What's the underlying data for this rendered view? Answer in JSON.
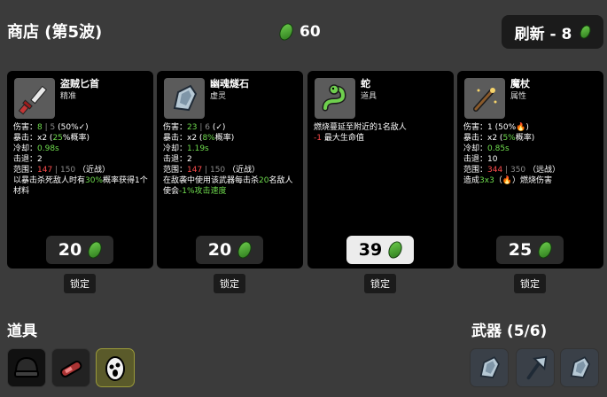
{
  "header": {
    "title": "商店 (第5波)",
    "materials": "60",
    "reroll_label": "刷新 - 8"
  },
  "shop_items": [
    {
      "name": "盗贼匕首",
      "class": "精准",
      "icon": "dagger-icon",
      "stats": [
        {
          "label": "伤害：",
          "parts": [
            {
              "t": "8",
              "c": "g"
            },
            {
              "t": " | ",
              "c": "gy"
            },
            {
              "t": "5",
              "c": "gy"
            },
            {
              "t": " (50%✓)",
              "c": ""
            }
          ]
        },
        {
          "label": "暴击：",
          "parts": [
            {
              "t": "x2 (",
              "c": ""
            },
            {
              "t": "25",
              "c": "g"
            },
            {
              "t": "%概率)",
              "c": ""
            }
          ]
        },
        {
          "label": "冷却：",
          "parts": [
            {
              "t": "0.98s",
              "c": "g"
            }
          ]
        },
        {
          "label": "击退：",
          "parts": [
            {
              "t": "2",
              "c": ""
            }
          ]
        },
        {
          "label": "范围：",
          "parts": [
            {
              "t": "147",
              "c": "r"
            },
            {
              "t": " | ",
              "c": "gy"
            },
            {
              "t": "150",
              "c": "gy"
            },
            {
              "t": " （近战）",
              "c": ""
            }
          ]
        }
      ],
      "desc_parts": [
        {
          "t": "以暴击杀死敌人时有",
          "c": ""
        },
        {
          "t": "30%",
          "c": "g"
        },
        {
          "t": "概率获得1个材料",
          "c": ""
        }
      ],
      "price": "20"
    },
    {
      "name": "幽魂燧石",
      "class": "虚灵",
      "icon": "ghost-flint-icon",
      "stats": [
        {
          "label": "伤害：",
          "parts": [
            {
              "t": "23",
              "c": "g"
            },
            {
              "t": " | ",
              "c": "gy"
            },
            {
              "t": "6",
              "c": "gy"
            },
            {
              "t": " (✓)",
              "c": ""
            }
          ]
        },
        {
          "label": "暴击：",
          "parts": [
            {
              "t": "x2 (",
              "c": ""
            },
            {
              "t": "8%",
              "c": "g"
            },
            {
              "t": "概率)",
              "c": ""
            }
          ]
        },
        {
          "label": "冷却：",
          "parts": [
            {
              "t": "1.19s",
              "c": "g"
            }
          ]
        },
        {
          "label": "击退：",
          "parts": [
            {
              "t": "2",
              "c": ""
            }
          ]
        },
        {
          "label": "范围：",
          "parts": [
            {
              "t": "147",
              "c": "r"
            },
            {
              "t": " | ",
              "c": "gy"
            },
            {
              "t": "150",
              "c": "gy"
            },
            {
              "t": " （近战）",
              "c": ""
            }
          ]
        }
      ],
      "desc_parts": [
        {
          "t": "在敌袭中使用该武器每击杀",
          "c": ""
        },
        {
          "t": "20",
          "c": "g"
        },
        {
          "t": "名敌人使会",
          "c": ""
        },
        {
          "t": "-1%攻击速度",
          "c": "g"
        }
      ],
      "price": "20"
    },
    {
      "name": "蛇",
      "class": "道具",
      "icon": "snake-icon",
      "stats": [],
      "desc_parts": [
        {
          "t": "燃烧蔓延至附近的1名敌人",
          "c": ""
        }
      ],
      "desc2_parts": [
        {
          "t": "-1",
          "c": "r"
        },
        {
          "t": " 最大生命值",
          "c": ""
        }
      ],
      "price": "39"
    },
    {
      "name": "魔杖",
      "class": "属性",
      "icon": "wand-icon",
      "stats": [
        {
          "label": "伤害：",
          "parts": [
            {
              "t": "1 (50%",
              "c": ""
            },
            {
              "t": "🔥",
              "c": ""
            },
            {
              "t": ")",
              "c": ""
            }
          ]
        },
        {
          "label": "暴击：",
          "parts": [
            {
              "t": "x2 (",
              "c": ""
            },
            {
              "t": "5%",
              "c": "g"
            },
            {
              "t": "概率)",
              "c": ""
            }
          ]
        },
        {
          "label": "冷却：",
          "parts": [
            {
              "t": "0.85s",
              "c": "g"
            }
          ]
        },
        {
          "label": "击退：",
          "parts": [
            {
              "t": "10",
              "c": ""
            }
          ]
        },
        {
          "label": "范围：",
          "parts": [
            {
              "t": "344",
              "c": "r"
            },
            {
              "t": " | ",
              "c": "gy"
            },
            {
              "t": "350",
              "c": "gy"
            },
            {
              "t": " （远战）",
              "c": ""
            }
          ]
        }
      ],
      "desc_parts": [
        {
          "t": "造成",
          "c": ""
        },
        {
          "t": "3x3",
          "c": "g"
        },
        {
          "t": "（🔥）燃烧伤害",
          "c": ""
        }
      ],
      "price": "25"
    }
  ],
  "lock_label": "锁定",
  "items_section": {
    "title": "道具",
    "items": [
      "beanie-icon",
      "sausage-icon",
      "egg-icon"
    ]
  },
  "weapons_section": {
    "title": "武器 (5/6)",
    "items": [
      "ghost-flint-icon",
      "axe-icon",
      "ghost-flint-icon"
    ]
  },
  "colors": {
    "accent_green": "#6fdc4e",
    "accent_red": "#ff4d4d",
    "card_bg": "#000000",
    "page_bg": "#3b3b3b"
  }
}
